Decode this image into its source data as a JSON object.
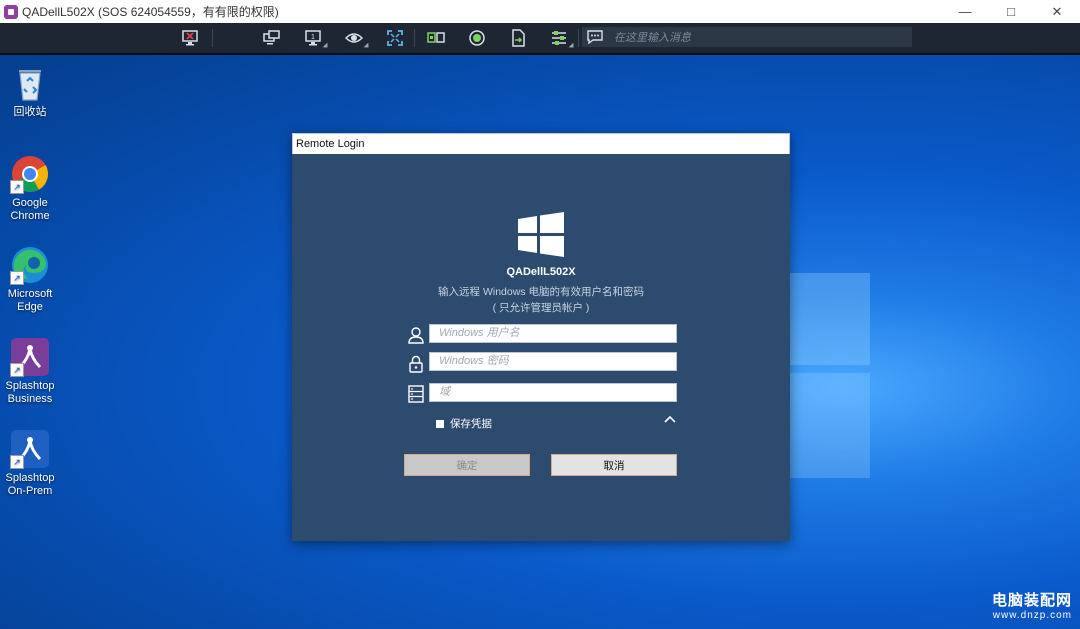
{
  "window": {
    "title": "QADellL502X (SOS 624054559，有有限的权限)"
  },
  "toolbar": {
    "icons": [
      "disconnect-icon",
      "switch-monitor-icon",
      "monitor-icon",
      "view-icon",
      "fullscreen-icon",
      "ctrl-alt-del-icon",
      "record-icon",
      "file-transfer-icon",
      "settings-icon",
      "chat-icon"
    ],
    "chat_placeholder": "在这里输入消息"
  },
  "desktop": {
    "icons": [
      {
        "label_line1": "回收站",
        "label_line2": ""
      },
      {
        "label_line1": "Google",
        "label_line2": "Chrome"
      },
      {
        "label_line1": "Microsoft",
        "label_line2": "Edge"
      },
      {
        "label_line1": "Splashtop",
        "label_line2": "Business"
      },
      {
        "label_line1": "Splashtop",
        "label_line2": "On-Prem"
      }
    ],
    "watermark_line1": "电脑装配网",
    "watermark_line2": "www.dnzp.com"
  },
  "dialog": {
    "title": "Remote Login",
    "host": "QADellL502X",
    "description": "输入远程 Windows 电脑的有效用户名和密码",
    "note": "( 只允许管理员帐户 )",
    "username_placeholder": "Windows 用户名",
    "password_placeholder": "Windows 密码",
    "domain_placeholder": "域",
    "save_credentials_label": "保存凭据",
    "save_credentials_checked": false,
    "ok_label": "确定",
    "cancel_label": "取消"
  }
}
